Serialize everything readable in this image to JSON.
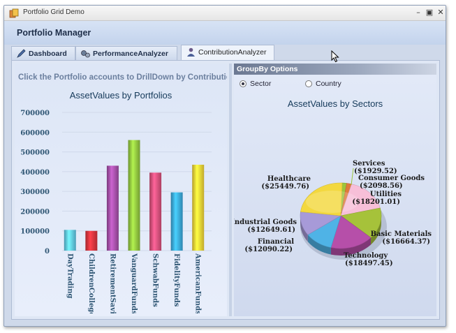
{
  "window": {
    "title": "Portfolio Grid Demo",
    "minimize": "–",
    "maximize": "▣",
    "close": "✕"
  },
  "header": {
    "title": "Portfolio Manager"
  },
  "tabs": [
    {
      "label": "Dashboard",
      "icon": "pen-icon"
    },
    {
      "label": "PerformanceAnalyzer",
      "icon": "gears-icon"
    },
    {
      "label": "ContributionAnalyzer",
      "icon": "person-icon",
      "active": true
    }
  ],
  "left": {
    "instruction": "Click the Portfolio accounts to DrillDown by Contribution"
  },
  "groupby": {
    "title": "GroupBy Options",
    "options": [
      {
        "label": "Sector",
        "selected": true
      },
      {
        "label": "Country",
        "selected": false
      }
    ]
  },
  "chart_data": [
    {
      "type": "bar",
      "title": "AssetValues by Portfolios",
      "categories": [
        "DayTrading",
        "ChildrenCollegeSavings",
        "RetirementSavings",
        "VanguardFunds",
        "SchwabFunds",
        "FidelityFunds",
        "AmericanFunds"
      ],
      "values": [
        105000,
        100000,
        430000,
        560000,
        395000,
        295000,
        435000
      ],
      "colors": [
        "#5fc6e6",
        "#d9343d",
        "#a34fa6",
        "#8fc23f",
        "#d9507b",
        "#3aa7dc",
        "#f2d336"
      ],
      "ylim": [
        0,
        700000
      ],
      "yticks": [
        "0",
        "100000",
        "200000",
        "300000",
        "400000",
        "500000",
        "600000",
        "700000"
      ]
    },
    {
      "type": "pie",
      "title": "AssetValues by Sectors",
      "slices": [
        {
          "name": "Services",
          "value": 1929.52,
          "label": "($1929.52)",
          "color": "#9dc43c"
        },
        {
          "name": "Consumer Goods",
          "value": 2098.56,
          "label": "($2098.56)",
          "color": "#e07a3a"
        },
        {
          "name": "Utilities",
          "value": 18201.01,
          "label": "($18201.01)",
          "color": "#f7bfd8"
        },
        {
          "name": "Basic Materials",
          "value": 16664.37,
          "label": "($16664.37)",
          "color": "#a6c23a"
        },
        {
          "name": "Technology",
          "value": 18497.45,
          "label": "($18497.45)",
          "color": "#b64fa9"
        },
        {
          "name": "Financial",
          "value": 12090.22,
          "label": "($12090.22)",
          "color": "#4fb3e6"
        },
        {
          "name": "Industrial Goods",
          "value": 12649.61,
          "label": "($12649.61)",
          "color": "#a79ad8"
        },
        {
          "name": "Healthcare",
          "value": 25449.76,
          "label": "($25449.76)",
          "color": "#f3d83f"
        }
      ]
    }
  ]
}
